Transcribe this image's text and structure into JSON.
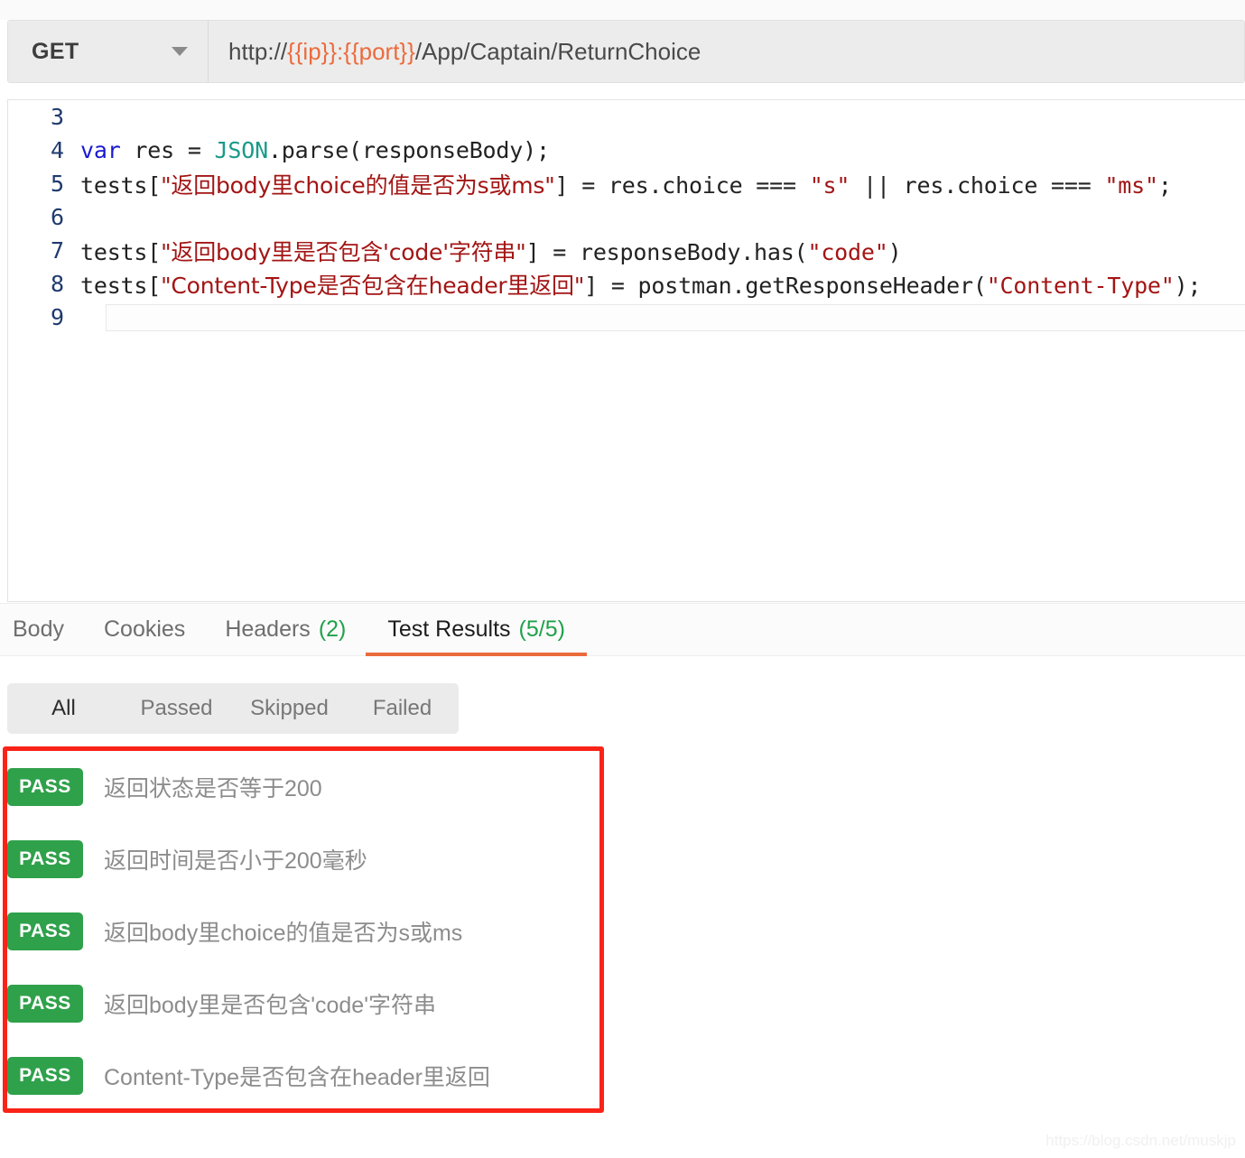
{
  "request": {
    "method": "GET",
    "method_caret": "chevron-down-icon",
    "url_prefix": "http://",
    "url_var_ip": "{{ip}}",
    "url_colon": ":",
    "url_var_port": "{{port}}",
    "url_path": "/App/Captain/ReturnChoice",
    "url_full": "http://{{ip}}:{{port}}/App/Captain/ReturnChoice",
    "accent_color": "#eb6b3c"
  },
  "editor": {
    "lines": [
      {
        "num": "3",
        "kind": "blank"
      },
      {
        "num": "4",
        "kind": "code",
        "text": "var res = JSON.parse(responseBody);"
      },
      {
        "num": "5",
        "kind": "code",
        "text": "tests[\"返回body里choice的值是否为s或ms\"] = res.choice === \"s\" || res.choice === \"ms\";"
      },
      {
        "num": "6",
        "kind": "blank"
      },
      {
        "num": "7",
        "kind": "code",
        "text": "tests[\"返回body里是否包含'code'字符串\"] = responseBody.has(\"code\")"
      },
      {
        "num": "8",
        "kind": "code",
        "text": "tests[\"Content-Type是否包含在header里返回\"] = postman.getResponseHeader(\"Content-Type\");"
      },
      {
        "num": "9",
        "kind": "active"
      }
    ],
    "tokens": {
      "keyword": "var",
      "class": "JSON",
      "l4_a": " res = ",
      "l4_b": ".parse(responseBody);",
      "l5_a": "tests[",
      "l5_str": "\"返回body里choice的值是否为s或ms\"",
      "l5_b": "] = res.choice === ",
      "l5_s": "\"s\"",
      "l5_c": " || res.choice === ",
      "l5_ms": "\"ms\"",
      "l5_d": ";",
      "l7_a": "tests[",
      "l7_str": "\"返回body里是否包含'code'字符串\"",
      "l7_b": "] = responseBody.has(",
      "l7_code": "\"code\"",
      "l7_c": ")",
      "l8_a": "tests[",
      "l8_str": "\"Content-Type是否包含在header里返回\"",
      "l8_b": "] = postman.getResponseHeader(",
      "l8_ct": "\"Content-Type\"",
      "l8_c": ");"
    }
  },
  "response": {
    "tabs": [
      {
        "label": "Body",
        "count": "",
        "active": false
      },
      {
        "label": "Cookies",
        "count": "",
        "active": false
      },
      {
        "label": "Headers",
        "count": "(2)",
        "active": false
      },
      {
        "label": "Test Results",
        "count": "(5/5)",
        "active": true
      }
    ],
    "filters": [
      {
        "label": "All",
        "selected": true
      },
      {
        "label": "Passed",
        "selected": false
      },
      {
        "label": "Skipped",
        "selected": false
      },
      {
        "label": "Failed",
        "selected": false
      }
    ],
    "results": [
      {
        "status": "PASS",
        "name": "返回状态是否等于200"
      },
      {
        "status": "PASS",
        "name": "返回时间是否小于200毫秒"
      },
      {
        "status": "PASS",
        "name": "返回body里choice的值是否为s或ms"
      },
      {
        "status": "PASS",
        "name": "返回body里是否包含'code'字符串"
      },
      {
        "status": "PASS",
        "name": "Content-Type是否包含在header里返回"
      }
    ],
    "pass_color": "#2fa14b",
    "count_color": "#20a14b"
  },
  "annotation": {
    "color": "#fa2318"
  },
  "watermark": {
    "text": "https://blog.csdn.net/muskjp"
  }
}
